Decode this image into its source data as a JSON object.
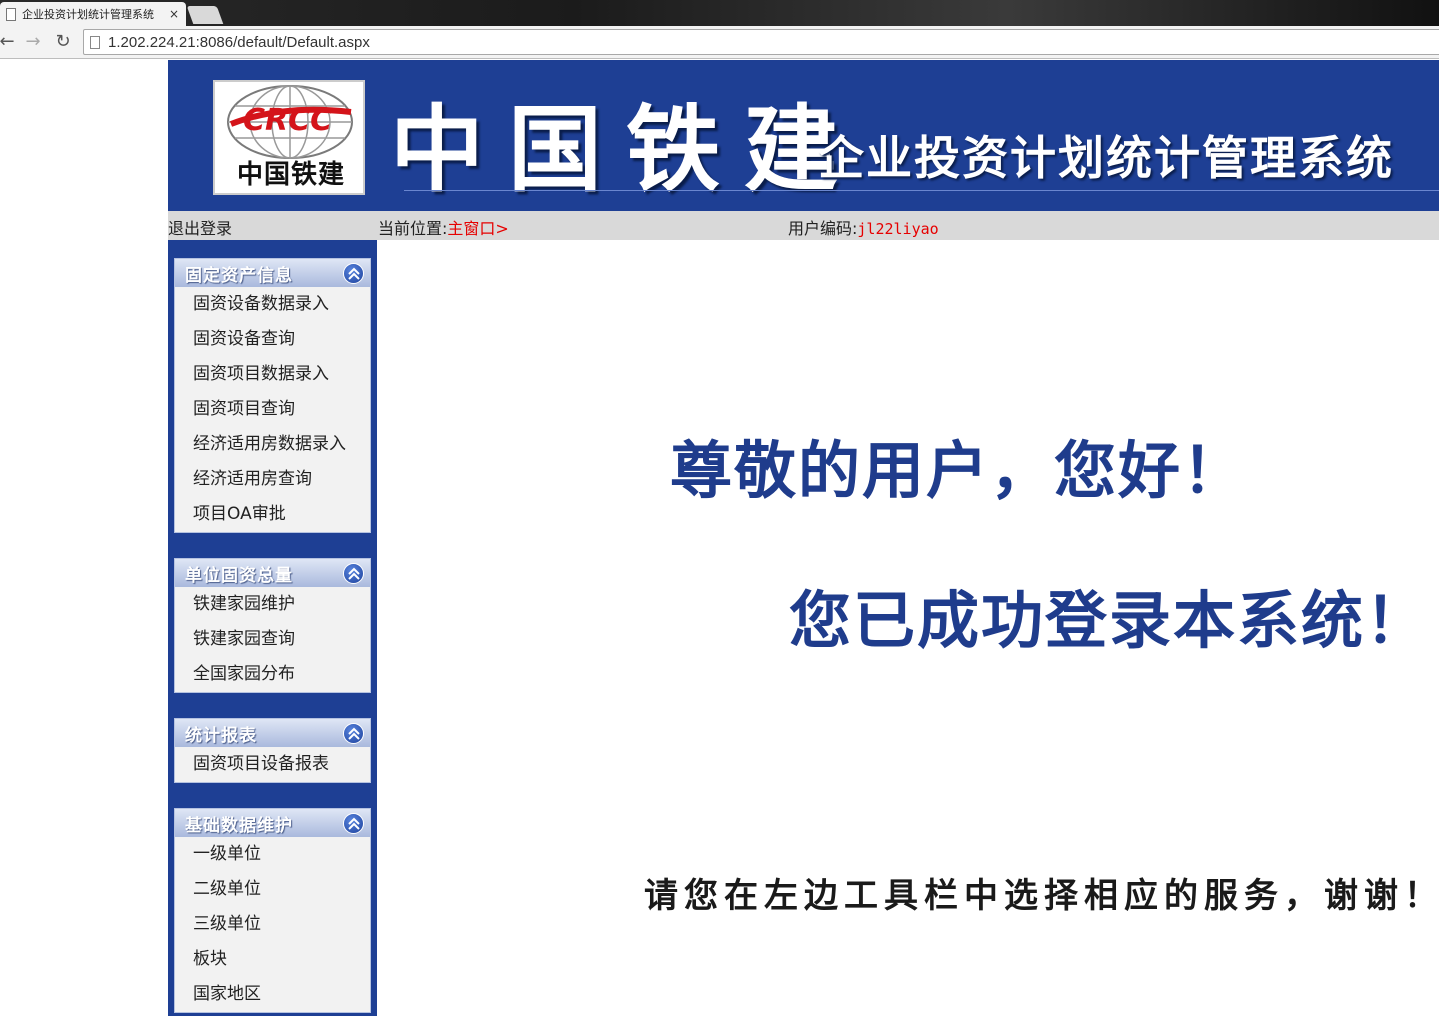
{
  "browser": {
    "tab_title": "企业投资计划统计管理系统",
    "tab_close": "×",
    "url": "1.202.224.21:8086/default/Default.aspx"
  },
  "banner": {
    "logo_text": "中国铁建",
    "logo_mark": "CRCC",
    "brand": "中国铁建",
    "system_name": "企业投资计划统计管理系统"
  },
  "infobar": {
    "logout": "退出登录",
    "location_label": "当前位置:",
    "location_value": "主窗口>",
    "user_label": "用户编码:",
    "user_value": "jl22liyao"
  },
  "sidebar": {
    "panels": [
      {
        "title": "固定资产信息",
        "items": [
          "固资设备数据录入",
          "固资设备查询",
          "固资项目数据录入",
          "固资项目查询",
          "经济适用房数据录入",
          "经济适用房查询",
          "项目OA审批"
        ]
      },
      {
        "title": "单位固资总量",
        "items": [
          "铁建家园维护",
          "铁建家园查询",
          "全国家园分布"
        ]
      },
      {
        "title": "统计报表",
        "items": [
          "固资项目设备报表"
        ]
      },
      {
        "title": "基础数据维护",
        "items": [
          "一级单位",
          "二级单位",
          "三级单位",
          "板块",
          "国家地区"
        ]
      }
    ]
  },
  "main": {
    "greeting": "尊敬的用户，您好！",
    "success": "您已成功登录本系统！",
    "hint": "请您在左边工具栏中选择相应的服务，谢谢！"
  },
  "colors": {
    "banner_blue": "#1e3f94",
    "alert_red": "#e60000",
    "greeting_blue": "#1f3c8c"
  }
}
